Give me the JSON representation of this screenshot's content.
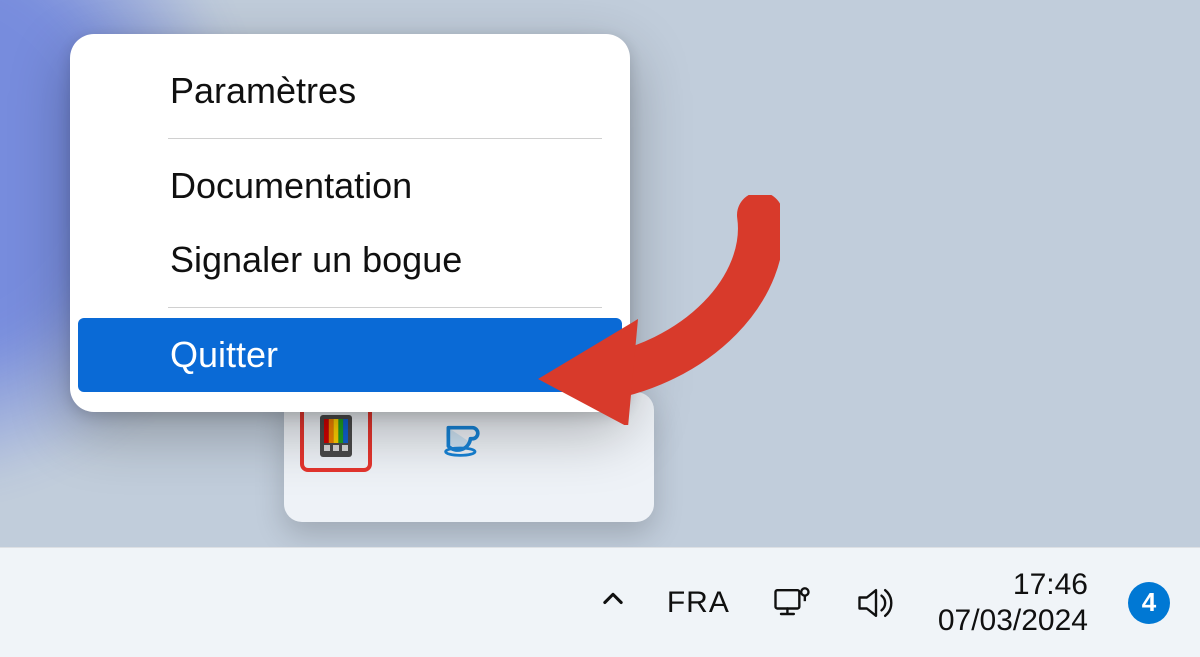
{
  "context_menu": {
    "items": [
      {
        "label": "Paramètres"
      },
      {
        "label": "Documentation"
      },
      {
        "label": "Signaler un bogue"
      },
      {
        "label": "Quitter",
        "highlighted": true
      }
    ]
  },
  "tray_flyout": {
    "icons": [
      {
        "name": "powertoys-icon",
        "highlighted": true
      },
      {
        "name": "coffee-cup-icon"
      }
    ]
  },
  "taskbar": {
    "language": "FRA",
    "time": "17:46",
    "date": "07/03/2024",
    "notification_count": "4"
  },
  "annotation": {
    "arrow_color": "#d83a2b"
  }
}
